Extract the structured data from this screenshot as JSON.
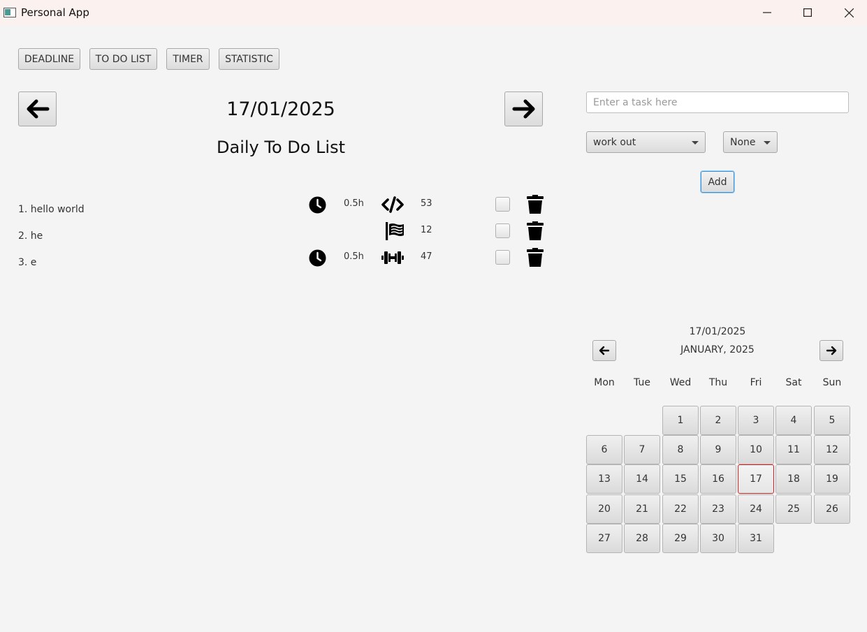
{
  "window": {
    "title": "Personal App"
  },
  "nav": {
    "deadline": "DEADLINE",
    "todo": "TO DO LIST",
    "timer": "TIMER",
    "statistic": "STATISTIC"
  },
  "main": {
    "date": "17/01/2025",
    "list_title": "Daily To Do List",
    "tasks": [
      {
        "label": "1. hello world",
        "duration": "0.5h",
        "category_icon": "code-icon",
        "value": "53",
        "done": false
      },
      {
        "label": "2. he",
        "duration": "",
        "category_icon": "flag-icon",
        "value": "12",
        "done": false
      },
      {
        "label": "3. e",
        "duration": "0.5h",
        "category_icon": "dumbbell-icon",
        "value": "47",
        "done": false
      }
    ]
  },
  "form": {
    "task_placeholder": "Enter a task here",
    "task_value": "",
    "category": "work out",
    "priority": "None",
    "add_label": "Add"
  },
  "calendar": {
    "selected_date": "17/01/2025",
    "month_label": "JANUARY, 2025",
    "weekdays": [
      "Mon",
      "Tue",
      "Wed",
      "Thu",
      "Fri",
      "Sat",
      "Sun"
    ],
    "days": [
      "1",
      "2",
      "3",
      "4",
      "5",
      "6",
      "7",
      "8",
      "9",
      "10",
      "11",
      "12",
      "13",
      "14",
      "15",
      "16",
      "17",
      "18",
      "19",
      "20",
      "21",
      "22",
      "23",
      "24",
      "25",
      "26",
      "27",
      "28",
      "29",
      "30",
      "31"
    ],
    "today": "17",
    "today_border_color": "#d62020"
  }
}
